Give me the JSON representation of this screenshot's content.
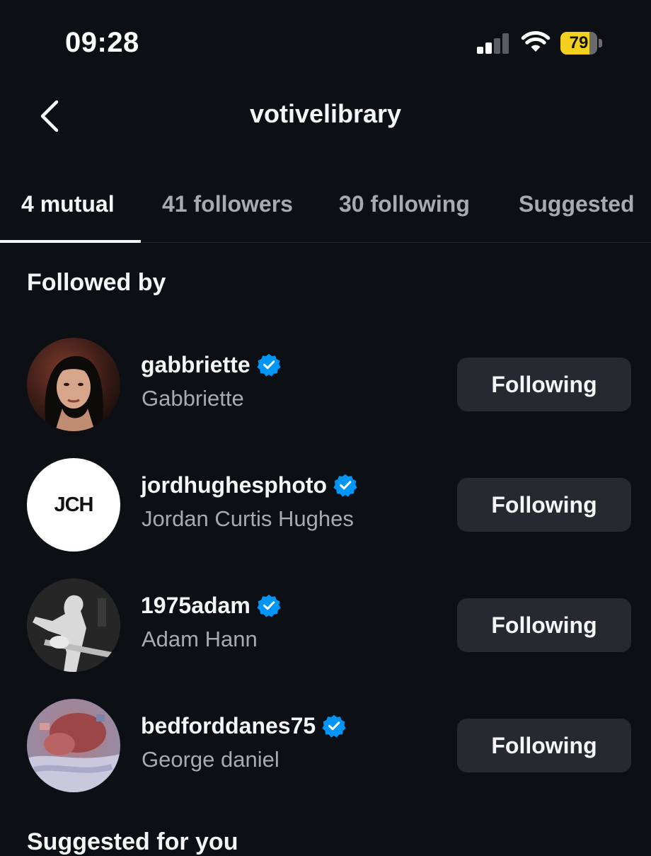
{
  "status_bar": {
    "time": "09:28",
    "battery_level": "79",
    "battery_color": "#f4d01e",
    "signal_icon": "cellular-signal-icon",
    "wifi_icon": "wifi-icon"
  },
  "header": {
    "title": "votivelibrary",
    "back_icon": "chevron-left-icon"
  },
  "tabs": [
    {
      "label": "4 mutual",
      "active": true
    },
    {
      "label": "41 followers",
      "active": false
    },
    {
      "label": "30 following",
      "active": false
    },
    {
      "label": "Suggested",
      "active": false
    }
  ],
  "section": {
    "title": "Followed by"
  },
  "users": [
    {
      "username": "gabbriette",
      "full_name": "Gabbriette",
      "verified": true,
      "button_label": "Following"
    },
    {
      "username": "jordhughesphoto",
      "full_name": "Jordan Curtis Hughes",
      "verified": true,
      "button_label": "Following",
      "avatar_text": "JCH"
    },
    {
      "username": "1975adam",
      "full_name": "Adam Hann",
      "verified": true,
      "button_label": "Following"
    },
    {
      "username": "bedforddanes75",
      "full_name": "George daniel",
      "verified": true,
      "button_label": "Following"
    }
  ],
  "suggested_section": {
    "title": "Suggested for you"
  },
  "colors": {
    "background": "#0c1014",
    "verified_badge": "#0095f6",
    "button_bg": "#26292f",
    "secondary_text": "#a6abb3"
  }
}
